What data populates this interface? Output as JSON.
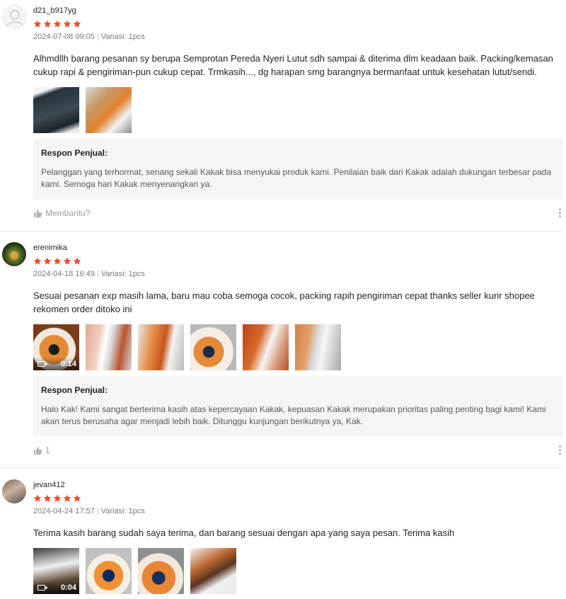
{
  "colors": {
    "star": "#ee4d2d",
    "seller_box_bg": "#f5f5f5"
  },
  "reviews": [
    {
      "username": "d21_b917yg",
      "rating": 5,
      "date": "2024-07-08 09:05",
      "variation": "Variasi: 1pcs",
      "comment": "Alhmdllh barang pesanan sy berupa Semprotan Pereda Nyeri Lutut sdh sampai & diterima dlm keadaan baik. Packing/kemasan cukup rapi & pengiriman-pun cukup cepat. Trmkasih..., dg harapan smg barangnya bermanfaat untuk kesehatan lutut/sendi.",
      "media": [
        {
          "type": "image"
        },
        {
          "type": "image"
        }
      ],
      "seller_response_title": "Respon Penjual:",
      "seller_response": "Pelanggan yang terhormat, senang sekali Kakak bisa menyukai produk kami. Penilaian baik dari Kakak adalah dukungan terbesar pada kami. Semoga hari Kakak menyenangkan ya.",
      "helpful_label": "Membantu?"
    },
    {
      "username": "erenimika",
      "rating": 5,
      "date": "2024-04-18 16:49",
      "variation": "Variasi: 1pcs",
      "comment": "Sesuai pesanan exp masih lama, baru mau coba semoga cocok, packing rapih pengiriman cepat thanks seller kurir shopee rekomen order ditoko ini",
      "media": [
        {
          "type": "video",
          "duration": "0:14"
        },
        {
          "type": "image"
        },
        {
          "type": "image"
        },
        {
          "type": "image"
        },
        {
          "type": "image"
        },
        {
          "type": "image"
        }
      ],
      "seller_response_title": "Respon Penjual:",
      "seller_response": "Halo Kak! Kami sangat berterima kasih atas kepercayaan Kakak, kepuasan Kakak merupakan prioritas paling penting bagi kami! Kami akan terus berusaha agar menjadi lebih baik. Ditunggu kunjungan berikutnya ya, Kak.",
      "helpful_label": "1"
    },
    {
      "username": "jevan412",
      "rating": 5,
      "date": "2024-04-24 17:57",
      "variation": "Variasi: 1pcs",
      "comment": "Terima kasih barang sudah saya terima, dan barang sesuai dengan apa yang saya pesan. Terima kasih",
      "media": [
        {
          "type": "video",
          "duration": "0:04"
        },
        {
          "type": "image"
        },
        {
          "type": "image"
        },
        {
          "type": "image"
        }
      ]
    }
  ]
}
